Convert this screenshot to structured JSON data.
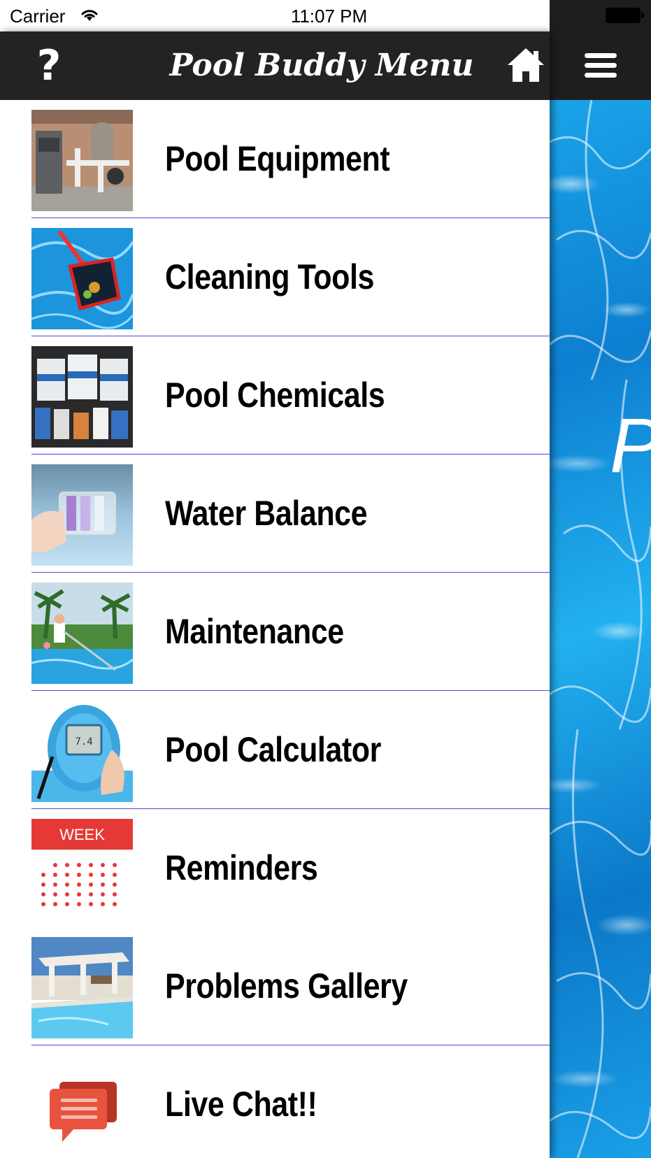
{
  "status_bar": {
    "carrier": "Carrier",
    "time": "11:07 PM"
  },
  "nav": {
    "title": "Pool Buddy Menu",
    "help_label": "?",
    "help_icon": "question-mark-icon",
    "home_icon": "home-icon",
    "menu_icon": "hamburger-menu-icon"
  },
  "background": {
    "visible_letter": "P"
  },
  "menu": {
    "items": [
      {
        "label": "Pool Equipment",
        "thumbnail": "pool-equipment-photo"
      },
      {
        "label": "Cleaning Tools",
        "thumbnail": "skimmer-net-photo"
      },
      {
        "label": "Pool Chemicals",
        "thumbnail": "chemical-buckets-photo"
      },
      {
        "label": "Water Balance",
        "thumbnail": "test-kit-photo"
      },
      {
        "label": "Maintenance",
        "thumbnail": "pool-cleaning-photo"
      },
      {
        "label": "Pool Calculator",
        "thumbnail": "digital-tester-photo"
      },
      {
        "label": "Reminders",
        "thumbnail": "week-calendar-icon",
        "thumb_text": "WEEK"
      },
      {
        "label": "Problems Gallery",
        "thumbnail": "pool-patio-photo"
      },
      {
        "label": "Live Chat!!",
        "thumbnail": "chat-bubble-icon"
      }
    ]
  },
  "colors": {
    "nav_background": "#232323",
    "divider": "#4a4adf",
    "calendar_red": "#e53935",
    "chat_red": "#e8533f",
    "pool_blue": "#1aa3e8"
  }
}
